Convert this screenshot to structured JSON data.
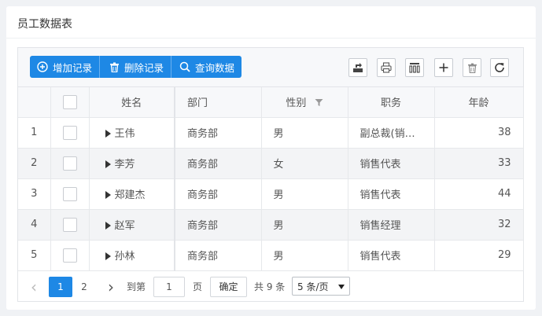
{
  "card": {
    "title": "员工数据表"
  },
  "toolbar": {
    "add_label": "增加记录",
    "delete_label": "删除记录",
    "query_label": "查询数据"
  },
  "table": {
    "headers": {
      "name": "姓名",
      "dept": "部门",
      "gender": "性别",
      "position": "职务",
      "age": "年龄"
    },
    "rows": [
      {
        "index": "1",
        "name": "王伟",
        "dept": "商务部",
        "gender": "男",
        "position": "副总裁(销…",
        "age": "38"
      },
      {
        "index": "2",
        "name": "李芳",
        "dept": "商务部",
        "gender": "女",
        "position": "销售代表",
        "age": "33"
      },
      {
        "index": "3",
        "name": "郑建杰",
        "dept": "商务部",
        "gender": "男",
        "position": "销售代表",
        "age": "44"
      },
      {
        "index": "4",
        "name": "赵军",
        "dept": "商务部",
        "gender": "男",
        "position": "销售经理",
        "age": "32"
      },
      {
        "index": "5",
        "name": "孙林",
        "dept": "商务部",
        "gender": "男",
        "position": "销售代表",
        "age": "29"
      }
    ]
  },
  "pager": {
    "prev": "‹",
    "next": "›",
    "page1": "1",
    "page2": "2",
    "goto_label": "到第",
    "goto_value": "1",
    "page_unit": "页",
    "confirm_label": "确定",
    "total_label": "共 9 条",
    "page_size": "5 条/页"
  },
  "colors": {
    "accent": "#1e88e5"
  },
  "icons": {
    "toolbar": [
      "plus-circle-icon",
      "trash-icon",
      "search-icon"
    ],
    "right_tools": [
      "export-icon",
      "print-icon",
      "columns-icon",
      "plus-icon",
      "trash-icon",
      "refresh-icon"
    ]
  }
}
